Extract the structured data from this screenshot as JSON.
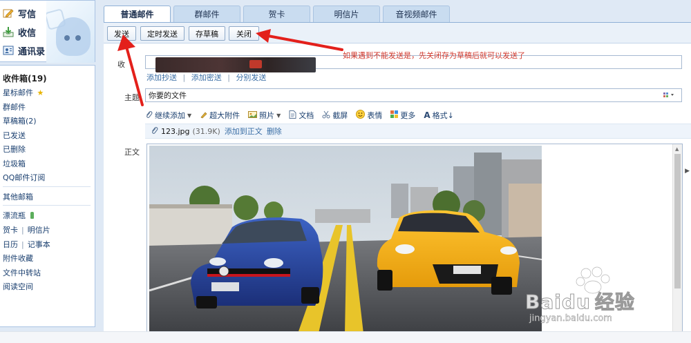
{
  "sidebar": {
    "actions": [
      {
        "label": "写信",
        "icon": "pencil-icon"
      },
      {
        "label": "收信",
        "icon": "inbox-icon"
      },
      {
        "label": "通讯录",
        "icon": "contacts-icon"
      }
    ],
    "folders": [
      {
        "label": "收件箱(19)"
      },
      {
        "label": "星标邮件",
        "star": "★"
      },
      {
        "label": "群邮件"
      },
      {
        "label": "草稿箱(2)"
      },
      {
        "label": "已发送"
      },
      {
        "label": "已删除"
      },
      {
        "label": "垃圾箱"
      },
      {
        "label": "QQ邮件订阅"
      }
    ],
    "other_mailbox": "其他邮箱",
    "apps": {
      "drift_bottle": "漂流瓶",
      "greeting_card": "贺卡",
      "postcard": "明信片",
      "calendar": "日历",
      "notepad": "记事本",
      "attach_favorites": "附件收藏",
      "file_transfer": "文件中转站",
      "reading_space": "阅读空间",
      "separator": "|"
    }
  },
  "tabs": [
    "普通邮件",
    "群邮件",
    "贺卡",
    "明信片",
    "音视频邮件"
  ],
  "toolbar": {
    "send": "发送",
    "scheduled_send": "定时发送",
    "save_draft": "存草稿",
    "close": "关闭"
  },
  "compose": {
    "to_label": "收",
    "cc_links": [
      "添加抄送",
      "添加密送",
      "分别发送"
    ],
    "cc_separator": "|",
    "subject_label": "主题",
    "subject_value": "你要的文件",
    "body_label": "正文",
    "format_tools": [
      {
        "label": "继续添加",
        "dropdown": "▼"
      },
      {
        "label": "超大附件"
      },
      {
        "label": "照片",
        "dropdown": "▼"
      },
      {
        "label": "文档"
      },
      {
        "label": "截屏"
      },
      {
        "label": "表情"
      },
      {
        "label": "更多"
      },
      {
        "label": "格式↓"
      }
    ],
    "attachment": {
      "name": "123.jpg",
      "size": "(31.9K)",
      "add_to_body": "添加到正文",
      "delete": "删除"
    }
  },
  "annotation": {
    "text": "如果遇到不能发送是，先关闭存为草稿后就可以发送了",
    "color": "#d23a2e"
  },
  "watermark": {
    "logo_text": "Bai",
    "logo_text2": "du",
    "logo_cn": "经验",
    "url": "jingyan.baidu.com"
  },
  "colors": {
    "accent": "#3a6ea5",
    "arrow_red": "#e3201b"
  }
}
